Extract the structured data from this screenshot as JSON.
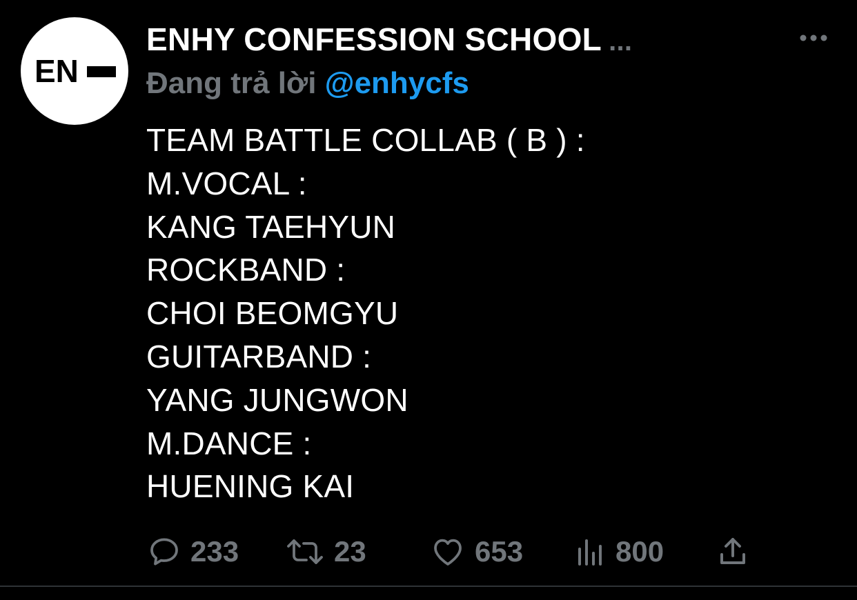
{
  "tweet": {
    "author_name": "ENHY CONFESSION SCHOOL",
    "name_ellipsis": "...",
    "reply_prefix": "Đang trả lời",
    "reply_handle": "@enhycfs",
    "avatar_text": "EN",
    "body_lines": [
      "TEAM BATTLE COLLAB ( B ) :",
      "M.VOCAL :",
      "KANG TAEHYUN",
      "ROCKBAND :",
      "CHOI BEOMGYU",
      "GUITARBAND :",
      "YANG JUNGWON",
      "M.DANCE :",
      "HUENING KAI"
    ],
    "actions": {
      "reply_count": "233",
      "retweet_count": "23",
      "like_count": "653",
      "views_count": "800"
    }
  },
  "colors": {
    "background": "#000000",
    "text": "#ffffff",
    "muted": "#71767b",
    "link": "#1d9bf0"
  },
  "icons": [
    "more-icon",
    "reply-icon",
    "retweet-icon",
    "like-icon",
    "views-icon",
    "share-icon"
  ]
}
